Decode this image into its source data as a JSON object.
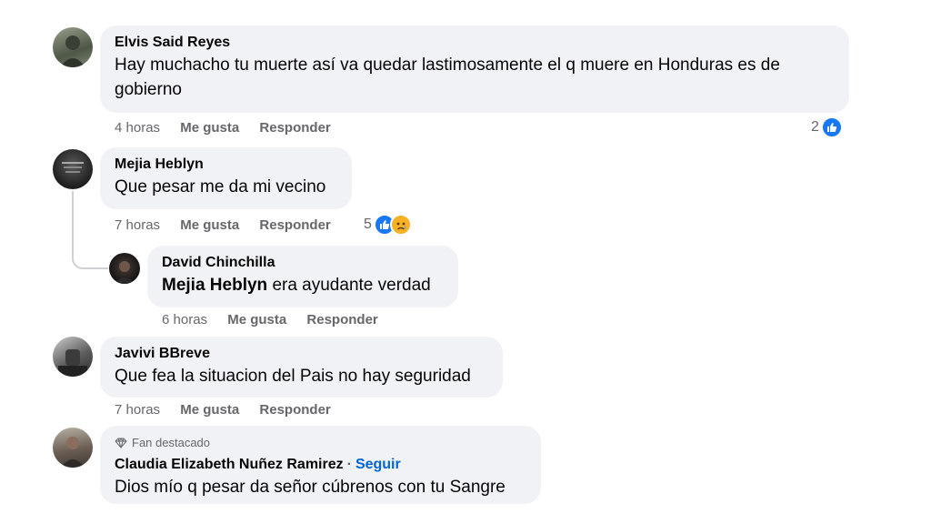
{
  "comments": [
    {
      "author": "Elvis Said Reyes",
      "text": "Hay muchacho tu muerte así va quedar lastimosamente el q muere en Honduras es de gobierno",
      "time": "4 horas",
      "like_label": "Me gusta",
      "reply_label": "Responder",
      "reaction_count": "2",
      "reactions": [
        "like-icon"
      ]
    },
    {
      "author": "Mejia Heblyn",
      "text": "Que pesar me da mi vecino",
      "time": "7 horas",
      "like_label": "Me gusta",
      "reply_label": "Responder",
      "reaction_count": "5",
      "reactions": [
        "like-icon",
        "sad-face-icon"
      ],
      "replies": [
        {
          "author": "David Chinchilla",
          "mention": "Mejia Heblyn",
          "text": "era ayudante verdad",
          "time": "6 horas",
          "like_label": "Me gusta",
          "reply_label": "Responder"
        }
      ]
    },
    {
      "author": "Javivi BBreve",
      "text": "Que fea la situacion del Pais no hay seguridad",
      "time": "7 horas",
      "like_label": "Me gusta",
      "reply_label": "Responder"
    },
    {
      "badge": "Fan destacado",
      "author": "Claudia Elizabeth Nuñez Ramirez",
      "follow_label": "Seguir",
      "separator": "·",
      "text": "Dios mío q pesar da señor cúbrenos con tu Sangre"
    }
  ],
  "colors": {
    "bubble_bg": "#f0f2f5",
    "meta_text": "#65676b",
    "link_blue": "#0064d1",
    "like_blue": "#1877f2",
    "sad_yellow": "#f7b125"
  }
}
